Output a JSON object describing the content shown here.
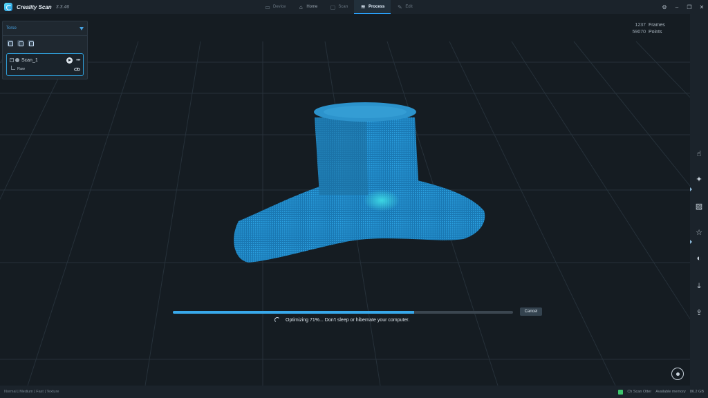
{
  "app": {
    "name": "Creality Scan",
    "version": "3.3.46"
  },
  "tabs": [
    {
      "label": "Device",
      "icon": "device-icon",
      "active": false
    },
    {
      "label": "Home",
      "icon": "home-icon",
      "active": false
    },
    {
      "label": "Scan",
      "icon": "scan-icon",
      "active": false
    },
    {
      "label": "Process",
      "icon": "process-icon",
      "active": true
    },
    {
      "label": "Edit",
      "icon": "edit-icon",
      "active": false
    }
  ],
  "scene_panel": {
    "title": "Torso",
    "scan": {
      "name": "Scan_1",
      "child": "Raw"
    }
  },
  "stats": {
    "frames_value": "1237",
    "frames_label": "Frames",
    "points_value": "59070",
    "points_label": "Points"
  },
  "progress": {
    "percent": 71,
    "cancel_label": "Cancel",
    "message": "Optimizing 71%... Don't sleep or hibernate your computer."
  },
  "right_tools": [
    "hand-point-icon",
    "magic-wand-icon",
    "layers-icon",
    "star-select-icon",
    "palette-icon",
    "download-icon",
    "export-icon"
  ],
  "statusbar": {
    "modes": "Normal | Medium | Fast | Texture",
    "otter": "Ch Scan Otter",
    "memory_label": "Available memory",
    "memory_value": "86.2 GB"
  },
  "colors": {
    "accent": "#38a8ea",
    "point_cloud": "#1f8fd0",
    "background": "#151c22"
  }
}
